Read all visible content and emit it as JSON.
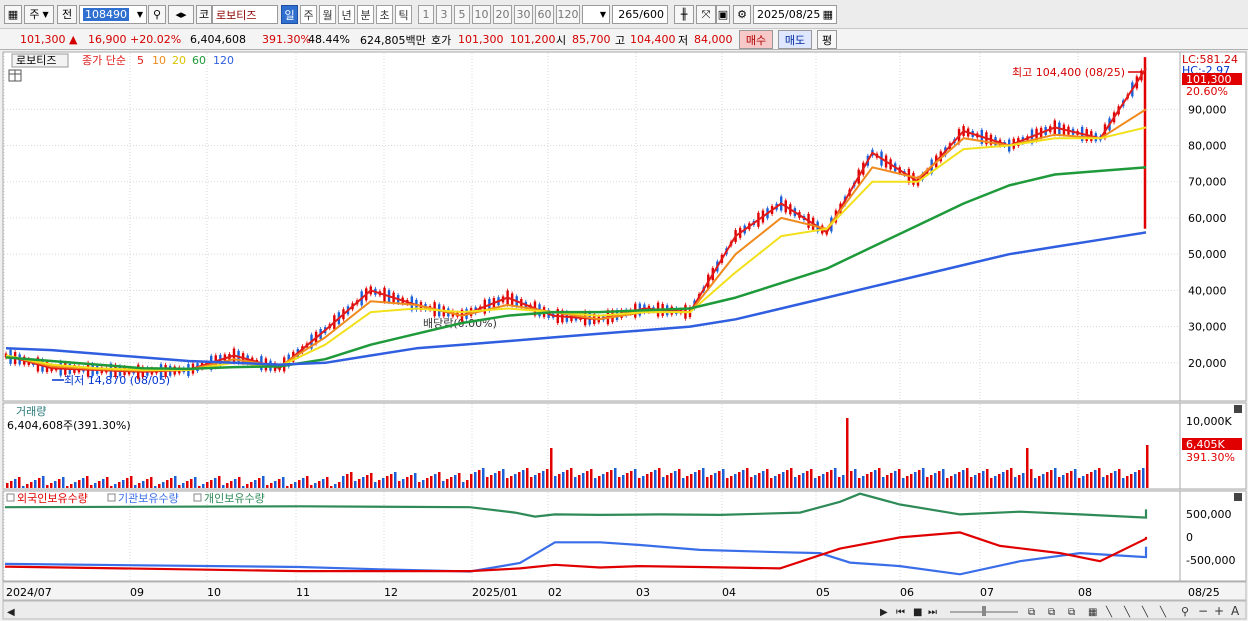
{
  "toolbar": {
    "market": "주",
    "prev": "전",
    "code": "108490",
    "exchange": "코",
    "name": "로보티즈",
    "periods": [
      "일",
      "주",
      "월",
      "년",
      "분",
      "초",
      "틱"
    ],
    "active_period": "일",
    "minutes": [
      "1",
      "3",
      "5",
      "10",
      "20",
      "30",
      "60",
      "120"
    ],
    "count": "265",
    "count_total": "/600",
    "date": "2025/08/25"
  },
  "quote": {
    "price": "101,300",
    "up_mark": "▲",
    "change": "16,900",
    "change_pct": "+20.02%",
    "volume": "6,404,608",
    "volume_pct": "391.30%",
    "turnover": "48.44%",
    "amount": "624,805백만",
    "ask_label": "호가",
    "ask": "101,300",
    "bid": "101,200",
    "open_label": "시",
    "open": "85,700",
    "high_label": "고",
    "high": "104,400",
    "low_label": "저",
    "low": "84,000",
    "buy": "매수",
    "sell": "매도",
    "eval": "평"
  },
  "colors": {
    "up": "#e00000",
    "down": "#1a5fd8",
    "ma5": "#e01b1b",
    "ma10": "#f08a1c",
    "ma20": "#f2e01a",
    "ma60": "#1f9a3a",
    "ma120": "#2f5fe0",
    "foreign": "#e00000",
    "institution": "#3a6ee8",
    "individual": "#2e8b57",
    "grid": "#d8d8d8"
  },
  "price_panel": {
    "legend_name": "로보티즈",
    "legend_prefix": "종가 단순",
    "ma_periods": [
      "5",
      "10",
      "20",
      "60",
      "120"
    ],
    "lc": "LC:581.24",
    "hc": "HC:-2.97",
    "current_tag": "101,300",
    "current_pct": "20.60%",
    "high_note": "최고 104,400 (08/25)",
    "low_note": "최저 14,870 (08/05)",
    "dividend_note": "배당락(0.00%)",
    "y_ticks": [
      "90,000",
      "80,000",
      "70,000",
      "60,000",
      "50,000",
      "40,000",
      "30,000",
      "20,000"
    ]
  },
  "volume_panel": {
    "title": "거래량",
    "value_label": "6,404,608주(391.30%)",
    "y_tick": "10,000K",
    "current_tag": "6,405K",
    "current_pct": "391.30%"
  },
  "holdings_panel": {
    "series_labels": [
      "외국인보유수량",
      "기관보유수량",
      "개인보유수량"
    ],
    "y_ticks": [
      "500,000",
      "0",
      "-500,000"
    ]
  },
  "x_axis": [
    "2024/07",
    "09",
    "10",
    "11",
    "12",
    "2025/01",
    "02",
    "03",
    "04",
    "05",
    "06",
    "07",
    "08",
    "08/25"
  ],
  "chart_data": {
    "type": "line",
    "title": "로보티즈",
    "series": [
      {
        "name": "5",
        "values": [
          22000,
          18500,
          18000,
          17500,
          18000,
          22000,
          18500,
          29000,
          40000,
          36000,
          33000,
          38000,
          33000,
          32000,
          35000,
          34000,
          55000,
          64000,
          56000,
          78000,
          70000,
          84000,
          80000,
          85000,
          82000,
          101300
        ]
      },
      {
        "name": "10",
        "values": [
          22000,
          19000,
          18200,
          17800,
          18000,
          21000,
          19000,
          27000,
          37000,
          36000,
          33000,
          36000,
          34000,
          32000,
          34000,
          34000,
          50000,
          60000,
          57000,
          74000,
          71000,
          82000,
          80000,
          83000,
          82000,
          90000
        ]
      },
      {
        "name": "20",
        "values": [
          22000,
          19500,
          18500,
          18000,
          18000,
          20000,
          19000,
          25000,
          34000,
          35000,
          34000,
          35000,
          34000,
          33000,
          34000,
          34000,
          45000,
          55000,
          57000,
          70000,
          70000,
          79000,
          80000,
          82000,
          82000,
          85000
        ]
      },
      {
        "name": "60",
        "values": [
          21500,
          20500,
          19500,
          18500,
          18300,
          18800,
          19000,
          21000,
          25000,
          28000,
          31000,
          33000,
          34000,
          34000,
          34500,
          35000,
          38000,
          42000,
          46000,
          52000,
          58000,
          64000,
          69000,
          72000,
          73000,
          74000
        ]
      },
      {
        "name": "120",
        "values": [
          24000,
          23500,
          22500,
          21500,
          20500,
          20000,
          19500,
          20000,
          22000,
          24000,
          25000,
          26000,
          27000,
          28000,
          29000,
          30000,
          32000,
          35000,
          38000,
          41000,
          44000,
          47000,
          50000,
          52000,
          54000,
          56000
        ]
      }
    ],
    "xlabel": "",
    "ylabel": "",
    "ylim": [
      10000,
      105000
    ],
    "legend": "top-left",
    "grid": true
  }
}
